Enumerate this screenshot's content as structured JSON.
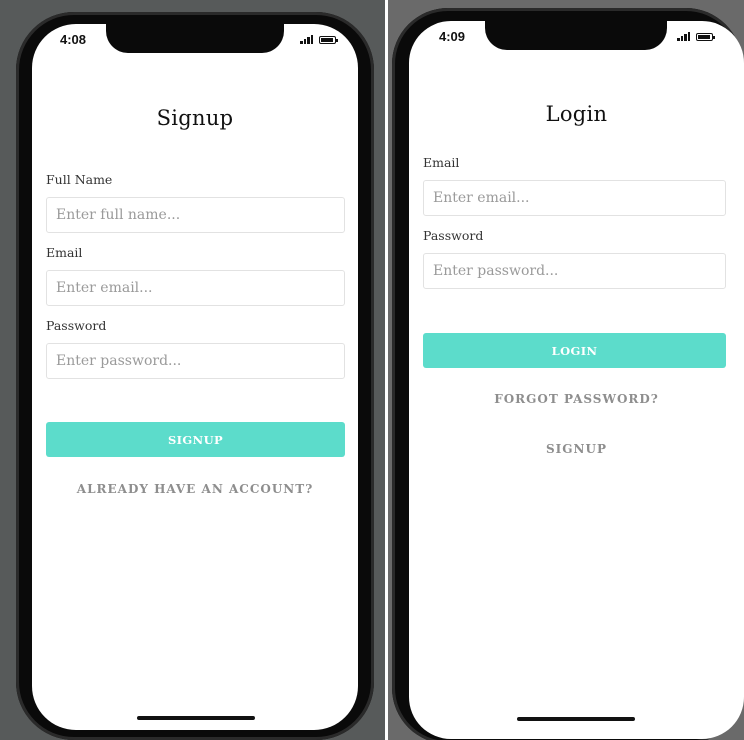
{
  "signup_screen": {
    "status_bar": {
      "time": "4:08"
    },
    "title": "Signup",
    "fields": [
      {
        "label": "Full Name",
        "placeholder": "Enter full name..."
      },
      {
        "label": "Email",
        "placeholder": "Enter email..."
      },
      {
        "label": "Password",
        "placeholder": "Enter password..."
      }
    ],
    "submit_label": "SIGNUP",
    "secondary_link": "ALREADY HAVE AN ACCOUNT?"
  },
  "login_screen": {
    "status_bar": {
      "time": "4:09"
    },
    "title": "Login",
    "fields": [
      {
        "label": "Email",
        "placeholder": "Enter email..."
      },
      {
        "label": "Password",
        "placeholder": "Enter password..."
      }
    ],
    "submit_label": "LOGIN",
    "forgot_link": "FORGOT PASSWORD?",
    "signup_link": "SIGNUP"
  },
  "colors": {
    "accent": "#5cdccb",
    "link_text": "#8e8e8e",
    "phone_frame": "#0a0a0a"
  },
  "icons": {
    "signal": "signal-icon",
    "battery": "battery-icon"
  }
}
